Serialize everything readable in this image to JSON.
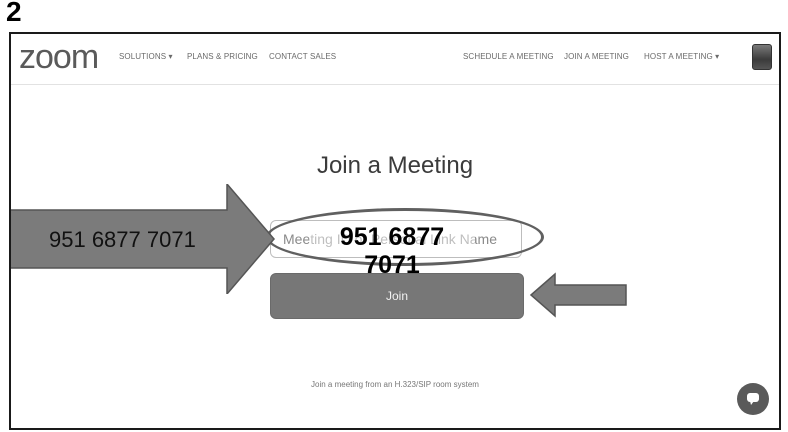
{
  "step_number": "2",
  "brand": {
    "logo_text": "zoom"
  },
  "nav": {
    "left_items": [
      "SOLUTIONS ▾",
      "PLANS & PRICING",
      "CONTACT SALES"
    ],
    "right_items": [
      "SCHEDULE A MEETING",
      "JOIN A MEETING",
      "HOST A MEETING ▾"
    ]
  },
  "main": {
    "title": "Join a Meeting",
    "input_placeholder": "Meeting ID or Personal Link Name",
    "join_button_label": "Join",
    "h323_link": "Join a meeting from an H.323/SIP room system"
  },
  "annotation": {
    "arrow_text": "951 6877 7071",
    "overlay_text": "951 6877 7071"
  },
  "colors": {
    "arrow_fill": "#7b7b7b",
    "button_fill": "#777777",
    "logo": "#5a5a5a"
  },
  "icons": {
    "avatar": "user-avatar-icon",
    "chat": "chat-bubble-icon"
  }
}
